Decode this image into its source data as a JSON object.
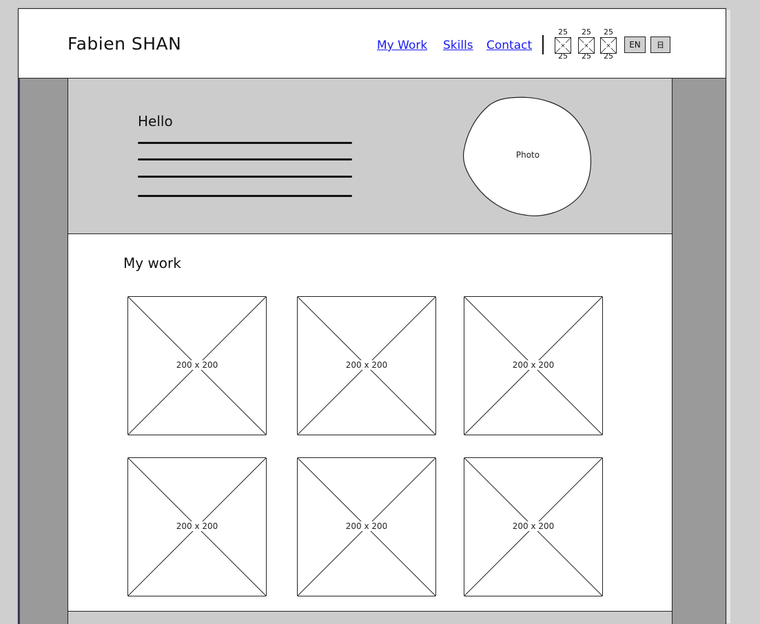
{
  "header": {
    "brand": "Fabien SHAN",
    "nav": [
      {
        "label": "My Work"
      },
      {
        "label": "Skills"
      },
      {
        "label": "Contact"
      }
    ],
    "social_icons": [
      {
        "icon": "image-placeholder-icon",
        "top_label": "25",
        "bottom_label": "25"
      },
      {
        "icon": "image-placeholder-icon",
        "top_label": "25",
        "bottom_label": "25"
      },
      {
        "icon": "image-placeholder-icon",
        "top_label": "25",
        "bottom_label": "25"
      }
    ],
    "language_button": "EN",
    "menu_button_icon": "menu-icon",
    "menu_button_glyph": "日"
  },
  "hero": {
    "greeting": "Hello",
    "photo_label": "Photo"
  },
  "work": {
    "title": "My work",
    "thumbnails": [
      {
        "label": "200 x 200"
      },
      {
        "label": "200 x 200"
      },
      {
        "label": "200 x 200"
      },
      {
        "label": "200 x 200"
      },
      {
        "label": "200 x 200"
      },
      {
        "label": "200 x 200"
      }
    ]
  },
  "colors": {
    "link": "#1a1aee",
    "hero_bg": "#cccccc",
    "gutter_bg": "#9a9a9a"
  }
}
